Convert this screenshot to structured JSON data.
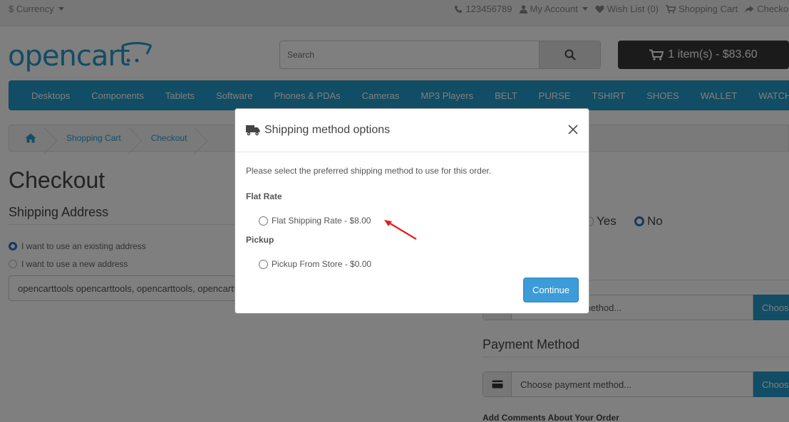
{
  "topbar": {
    "currency": "$ Currency",
    "phone": "123456789",
    "my_account": "My Account",
    "wish_list": "Wish List (0)",
    "shopping_cart": "Shopping Cart",
    "checkout": "Checkout"
  },
  "header": {
    "logo_text": "opencart",
    "search_placeholder": "Search",
    "cart_label": "1 item(s) - $83.60"
  },
  "menu": {
    "items": [
      "Desktops",
      "Components",
      "Tablets",
      "Software",
      "Phones & PDAs",
      "Cameras",
      "MP3 Players",
      "BELT",
      "PURSE",
      "TSHIRT",
      "SHOES",
      "WALLET",
      "WATCH"
    ]
  },
  "breadcrumb": {
    "items": [
      "Shopping Cart",
      "Checkout"
    ]
  },
  "page": {
    "title": "Checkout",
    "shipping_address_title": "Shipping Address",
    "existing_address_label": "I want to use an existing address",
    "new_address_label": "I want to use a new address",
    "selected_address": "opencarttools opencarttools, opencarttools, opencarttools",
    "yes_label": "Yes",
    "no_label": "No",
    "shipping_method_placeholder": "method...",
    "choose_label": "Choose",
    "payment_method_title": "Payment Method",
    "payment_method_placeholder": "Choose payment method...",
    "comments_label": "Add Comments About Your Order"
  },
  "modal": {
    "title": "Shipping method options",
    "intro": "Please select the preferred shipping method to use for this order.",
    "groups": [
      {
        "title": "Flat Rate",
        "option": "Flat Shipping Rate - $8.00"
      },
      {
        "title": "Pickup",
        "option": "Pickup From Store - $0.00"
      }
    ],
    "continue_label": "Continue"
  },
  "colors": {
    "brand_blue": "#229ac8",
    "continue_blue": "#3c9bd8",
    "arrow_red": "#e02020"
  }
}
